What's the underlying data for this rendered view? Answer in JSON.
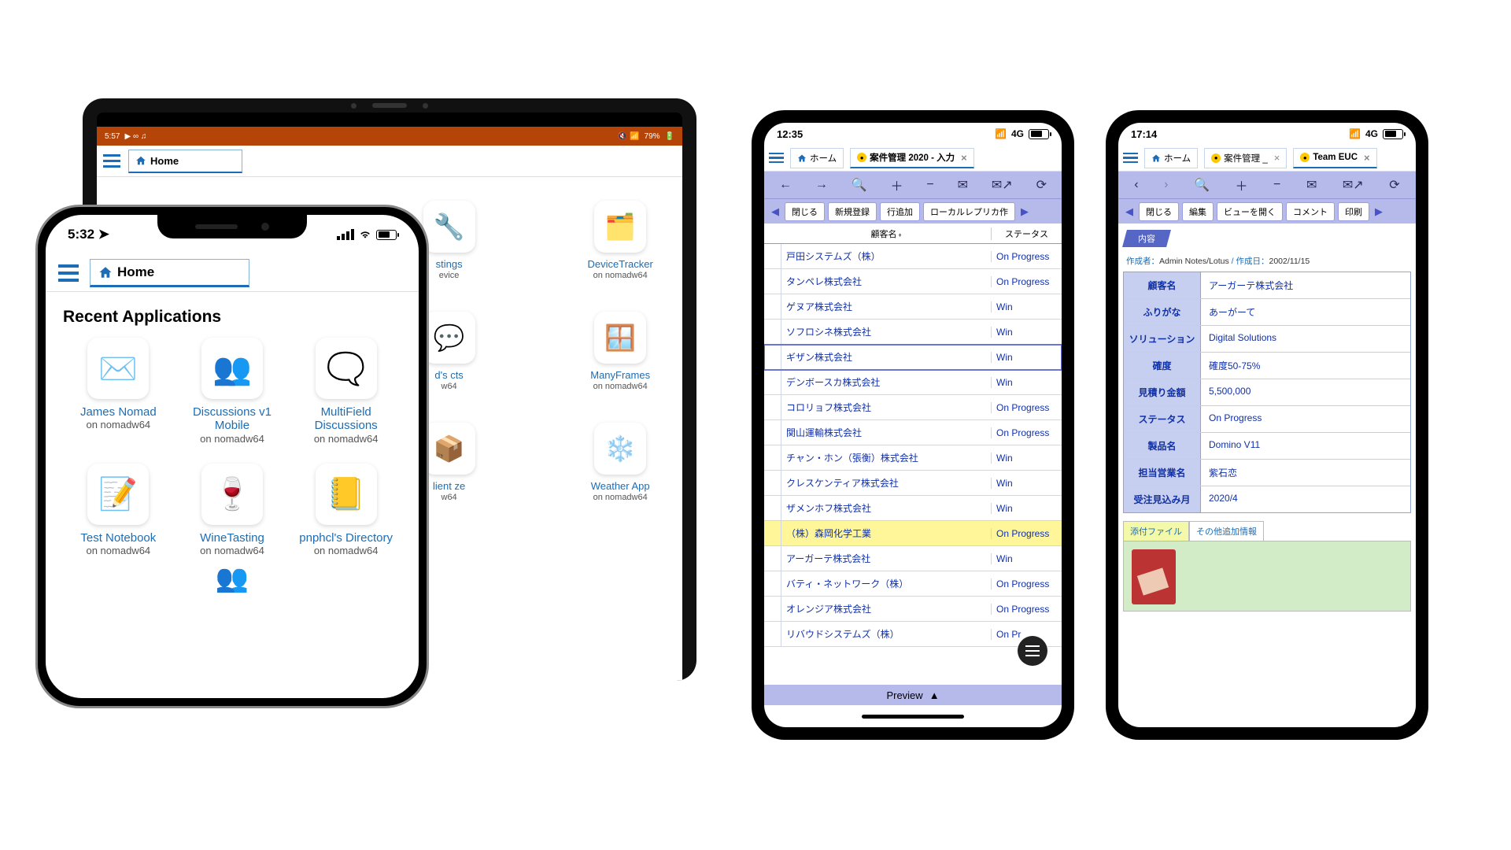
{
  "tablet": {
    "status": {
      "time": "5:57",
      "battery": "79%"
    },
    "home_label": "Home",
    "tiles": [
      {
        "name": "stings",
        "sub": "evice"
      },
      {
        "name": "DeviceTracker",
        "sub": "on nomadw64"
      },
      {
        "name": "d's\ncts",
        "sub": "w64"
      },
      {
        "name": "ManyFrames",
        "sub": "on nomadw64"
      },
      {
        "name": "lient\nze",
        "sub": "w64"
      },
      {
        "name": "Weather App",
        "sub": "on nomadw64"
      }
    ]
  },
  "iphone": {
    "status": {
      "time": "5:32"
    },
    "home_label": "Home",
    "recent_title": "Recent Applications",
    "tiles": [
      {
        "name": "James Nomad",
        "sub": "on nomadw64"
      },
      {
        "name": "Discussions v1 Mobile",
        "sub": "on nomadw64"
      },
      {
        "name": "MultiField Discussions",
        "sub": "on nomadw64"
      },
      {
        "name": "Test Notebook",
        "sub": "on nomadw64"
      },
      {
        "name": "WineTasting",
        "sub": "on nomadw64"
      },
      {
        "name": "pnphcl's Directory",
        "sub": "on nomadw64"
      }
    ]
  },
  "phoneA": {
    "status": {
      "time": "12:35",
      "net": "4G"
    },
    "tabs": {
      "home": "ホーム",
      "doc": "案件管理 2020 - 入力"
    },
    "buttons": [
      "閉じる",
      "新規登録",
      "行追加",
      "ローカルレプリカ作"
    ],
    "thead": {
      "c1": "顧客名",
      "c2": "ステータス"
    },
    "rows": [
      {
        "c1": "戸田システムズ（株）",
        "c2": "On Progress"
      },
      {
        "c1": "タンペレ株式会社",
        "c2": "On Progress"
      },
      {
        "c1": "ゲヌア株式会社",
        "c2": "Win"
      },
      {
        "c1": "ソフロシネ株式会社",
        "c2": "Win"
      },
      {
        "c1": "ギザン株式会社",
        "c2": "Win"
      },
      {
        "c1": "デンボースカ株式会社",
        "c2": "Win"
      },
      {
        "c1": "コロリョフ株式会社",
        "c2": "On Progress"
      },
      {
        "c1": "関山運輸株式会社",
        "c2": "On Progress"
      },
      {
        "c1": "チャン・ホン（張衡）株式会社",
        "c2": "Win"
      },
      {
        "c1": "クレスケンティア株式会社",
        "c2": "Win"
      },
      {
        "c1": "ザメンホフ株式会社",
        "c2": "Win"
      },
      {
        "c1": "（株）森岡化学工業",
        "c2": "On Progress"
      },
      {
        "c1": "アーガーテ株式会社",
        "c2": "Win"
      },
      {
        "c1": "バティ・ネットワーク（株）",
        "c2": "On Progress"
      },
      {
        "c1": "オレンジア株式会社",
        "c2": "On Progress"
      },
      {
        "c1": "リバウドシステムズ（株）",
        "c2": "On Pr"
      }
    ],
    "preview": "Preview"
  },
  "phoneB": {
    "status": {
      "time": "17:14",
      "net": "4G"
    },
    "tabs": {
      "home": "ホーム",
      "t1": "案件管理 _",
      "t2": "Team EUC"
    },
    "buttons": [
      "閉じる",
      "編集",
      "ビューを開く",
      "コメント",
      "印刷"
    ],
    "section": "内容",
    "meta": {
      "author_label": "作成者：",
      "author": "Admin Notes/Lotus",
      "date_label": "作成日：",
      "date": "2002/11/15"
    },
    "fields": [
      {
        "k": "顧客名",
        "v": "アーガーテ株式会社"
      },
      {
        "k": "ふりがな",
        "v": "あーがーて"
      },
      {
        "k": "ソリューション",
        "v": "Digital Solutions"
      },
      {
        "k": "確度",
        "v": "確度50-75%"
      },
      {
        "k": "見積り金額",
        "v": "5,500,000"
      },
      {
        "k": "ステータス",
        "v": "On Progress"
      },
      {
        "k": "製品名",
        "v": "Domino V11"
      },
      {
        "k": "担当営業名",
        "v": "紫石恋"
      },
      {
        "k": "受注見込み月",
        "v": "2020/4"
      }
    ],
    "att_tabs": [
      "添付ファイル",
      "その他追加情報"
    ]
  }
}
